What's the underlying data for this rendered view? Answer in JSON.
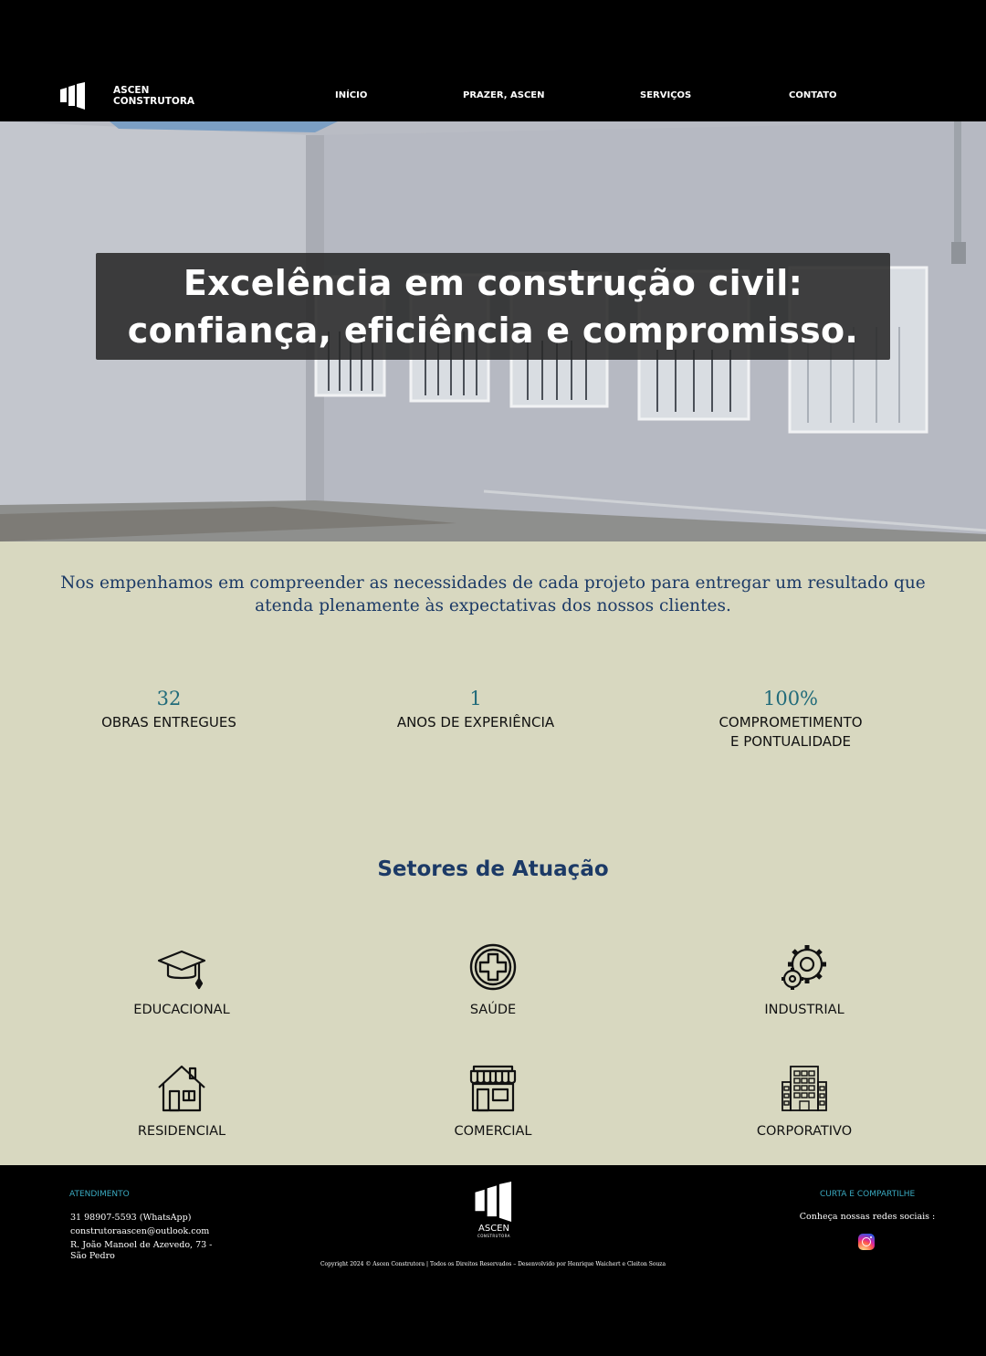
{
  "header": {
    "logo": {
      "line1": "ASCEN",
      "line2": "CONSTRUTORA"
    },
    "nav": [
      {
        "label": "INÍCIO"
      },
      {
        "label": "PRAZER, ASCEN"
      },
      {
        "label": "SERVIÇOS"
      },
      {
        "label": "CONTATO"
      }
    ]
  },
  "hero": {
    "title_line1": "Excelência em construção civil:",
    "title_line2": "confiança, eficiência e compromisso."
  },
  "intro": {
    "text": "Nos empenhamos em compreender as necessidades de cada projeto para entregar um resultado que atenda plenamente às expectativas dos nossos clientes."
  },
  "stats": [
    {
      "value": "32",
      "label": "OBRAS ENTREGUES"
    },
    {
      "value": "1",
      "label": "ANOS DE EXPERIÊNCIA"
    },
    {
      "value": "100%",
      "label_line1": "COMPROMETIMENTO",
      "label_line2": "E PONTUALIDADE"
    }
  ],
  "sectors": {
    "title": "Setores de Atuação",
    "items": [
      {
        "label": "EDUCACIONAL",
        "icon": "graduation-cap-icon"
      },
      {
        "label": "SAÚDE",
        "icon": "medical-cross-icon"
      },
      {
        "label": "INDUSTRIAL",
        "icon": "gears-icon"
      },
      {
        "label": "RESIDENCIAL",
        "icon": "house-icon"
      },
      {
        "label": "COMERCIAL",
        "icon": "store-icon"
      },
      {
        "label": "CORPORATIVO",
        "icon": "office-building-icon"
      }
    ]
  },
  "footer": {
    "attendance_heading": "ATENDIMENTO",
    "phone": "31 98907-5593 (WhatsApp)",
    "email": "construtoraascen@outlook.com",
    "address_line1": "R. João Manoel de Azevedo, 73 -",
    "address_line2": "São Pedro",
    "logo_text": "ASCEN",
    "logo_sub": "CONSTRUTORA",
    "copyright": "Copyright 2024 © Ascen Construtora | Todos os Direitos Reservados – Desenvolvido por Henrique Waichert e Cleiton Souza",
    "share_heading": "CURTA E COMPARTILHE",
    "social_text": "Conheça nossas redes sociais :",
    "social_icon": "instagram-icon"
  }
}
